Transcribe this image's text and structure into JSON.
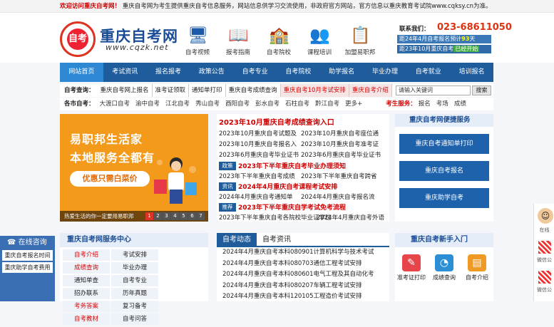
{
  "topbar": {
    "welcome": "欢迎访问重庆自考网！",
    "text": "重庆自考网为考生提供重庆自考信息服务，网站信息供学习交流使用，非政府官方网站，官方信息以重庆教育考试院www.cqksy.cn为准。"
  },
  "logo": {
    "circle": "自考",
    "title": "重庆自考网",
    "url": "www.cqzk.net"
  },
  "quicknav": [
    {
      "icon": "🖥",
      "label": "自考视频"
    },
    {
      "icon": "📖",
      "label": "报考指南"
    },
    {
      "icon": "🏫",
      "label": "自考院校"
    },
    {
      "icon": "👥",
      "label": "课程培训"
    },
    {
      "icon": "📋",
      "label": "加盟易职邦"
    }
  ],
  "contact": {
    "label": "联系我们：",
    "phone": "023-68611050",
    "line1": "距24年4月自考报名预计",
    "days1": "93",
    "unit": "天",
    "line2": "距23年10月重庆自考",
    "status": "已经开始"
  },
  "nav": [
    "网站首页",
    "考试资讯",
    "报名报考",
    "政策公告",
    "自考专业",
    "自考院校",
    "助学报名",
    "毕业办理",
    "自考就业",
    "培训报名"
  ],
  "query": {
    "label": "自考查询：",
    "links": [
      "重庆自考网上报名",
      "准考证领取",
      "通知单打印",
      "重庆自考成绩查询"
    ],
    "red": [
      "重庆自考10月考试安排",
      "重庆自考介绍"
    ],
    "search_placeholder": "请输入关键词",
    "search_btn": "搜索"
  },
  "cities": {
    "label": "各市自考：",
    "items": [
      "大渡口自考",
      "渝中自考",
      "江北自考",
      "秀山自考",
      "酉阳自考",
      "彭水自考",
      "石柱自考",
      "黔江自考",
      "更多+"
    ],
    "service_label": "考生服务：",
    "services": [
      "报名",
      "考场",
      "成绩"
    ]
  },
  "banner": {
    "t1": "易职邦生活家",
    "t2": "本地服务全都有",
    "btn": "优惠只需白菜价",
    "caption": "热爱生活的你一定要用易职邦",
    "dots": [
      "1",
      "2",
      "3",
      "4",
      "5",
      "6",
      "7"
    ]
  },
  "news": {
    "headline": "2023年10月重庆自考成绩查询入口",
    "rows": [
      [
        "2023年10月重庆自考试题及",
        "2023年10月重庆自考座位通"
      ],
      [
        "2023年10月重庆自考报名入",
        "2023年10月重庆自考准考证"
      ],
      [
        "2023年6月重庆自考毕业证书",
        "2023年6月重庆自考毕业证书"
      ]
    ],
    "tag1": "政策",
    "hl1": "2023年下半年重庆自考毕业办理须知",
    "rows2": [
      [
        "2023年下半年重庆自考成绩",
        "2023年下半年重庆自考跨省"
      ]
    ],
    "tag2": "资讯",
    "hl2": "2024年4月重庆自考课程考试安排",
    "rows3": [
      [
        "2024年4月重庆自考通知单",
        "2024年4月重庆自考报名流"
      ]
    ],
    "tag3": "推荐",
    "hl3": "2023年下半年重庆自学考试免考流程",
    "rows4": [
      [
        "2023年下半年重庆自考各院校毕业证学位",
        "2024年4月重庆自考外语"
      ]
    ]
  },
  "service": {
    "title": "重庆自考网便捷服务",
    "buttons": [
      "重庆自考通知单打印",
      "重庆自考报名",
      "重庆助学自考"
    ]
  },
  "online": {
    "title": "在线咨询",
    "items": [
      "重庆自考报名时间",
      "重庆助学自考费用"
    ]
  },
  "center": {
    "title": "重庆自考网服务中心",
    "items": [
      "自考介绍",
      "考试安排",
      "成绩查询",
      "毕业办理",
      "通知单查",
      "自考专业",
      "招办联系",
      "历年真题",
      "考务答案",
      "复习备考",
      "自考教材",
      "自考问答"
    ],
    "hot": [
      0,
      2,
      8,
      10
    ]
  },
  "dynamic": {
    "tab1": "自考动态",
    "tab2": "自考资讯",
    "items": [
      "2024年4月重庆自考本科080901计算机科学与技术考试",
      "2024年4月重庆自考本科080703通信工程考试安排",
      "2024年4月重庆自考本科080601电气工程及其自动化考",
      "2024年4月重庆自考本科080207车辆工程考试安排",
      "2024年4月重庆自考本科120105工程造价考试安排"
    ]
  },
  "newbie": {
    "title": "重庆自考新手入门",
    "items": [
      {
        "icon": "✎",
        "label": "准考证打印",
        "color": "#e6454a"
      },
      {
        "icon": "◔",
        "label": "成绩查询",
        "color": "#2c8fd6"
      },
      {
        "icon": "▤",
        "label": "自考介绍",
        "color": "#f09a26"
      }
    ]
  },
  "float": {
    "online": "在线",
    "wx1": "微信公",
    "wx2": "微信公"
  }
}
